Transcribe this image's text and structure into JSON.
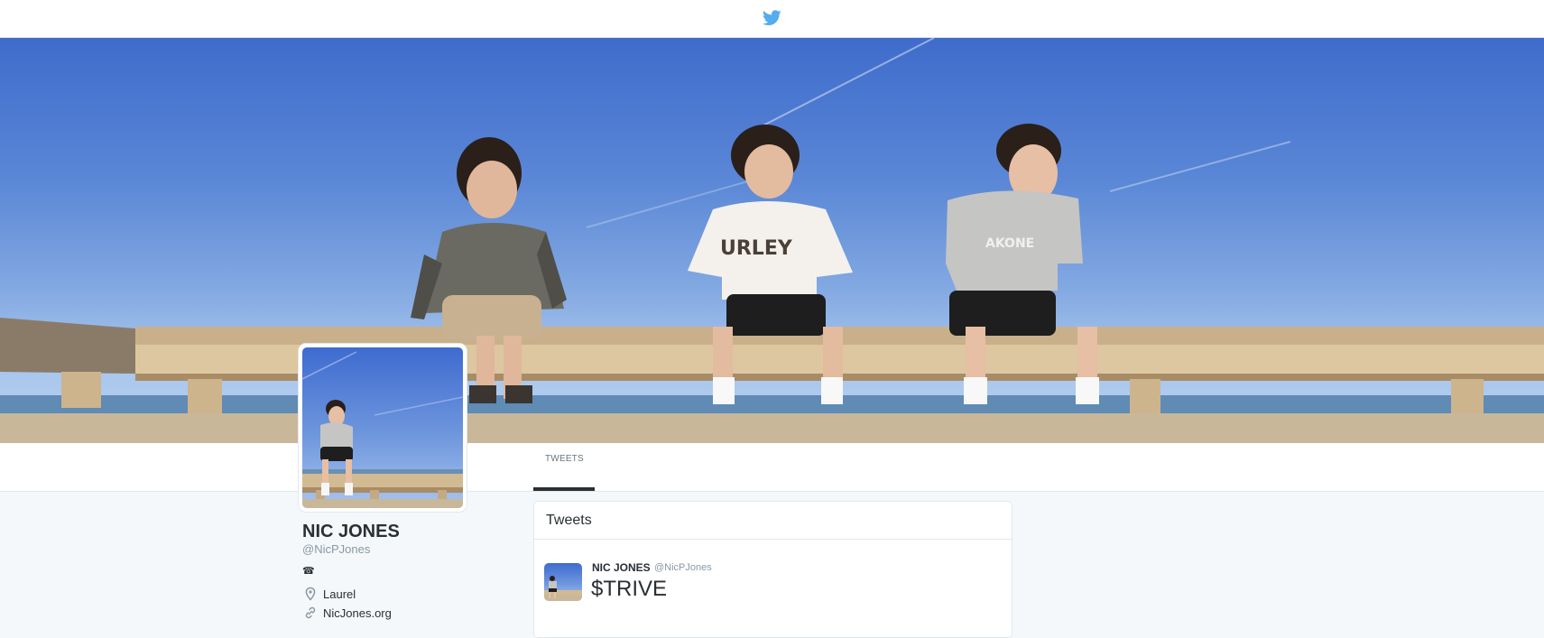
{
  "header": {
    "logo": "twitter-bird-icon",
    "brand_color": "#55acee"
  },
  "profile": {
    "name": "NIC JONES",
    "handle": "@NicPJones",
    "badge": "☎",
    "location": "Laurel",
    "website": "NicJones.org"
  },
  "nav": {
    "tabs": [
      {
        "label": "TWEETS",
        "active": true
      }
    ]
  },
  "timeline": {
    "heading": "Tweets",
    "tweets": [
      {
        "name": "NIC JONES",
        "handle": "@NicPJones",
        "text": "$TRIVE"
      }
    ]
  },
  "icons": {
    "location": "map-pin-icon",
    "website": "link-icon",
    "profile_badge": "telephone-icon"
  }
}
